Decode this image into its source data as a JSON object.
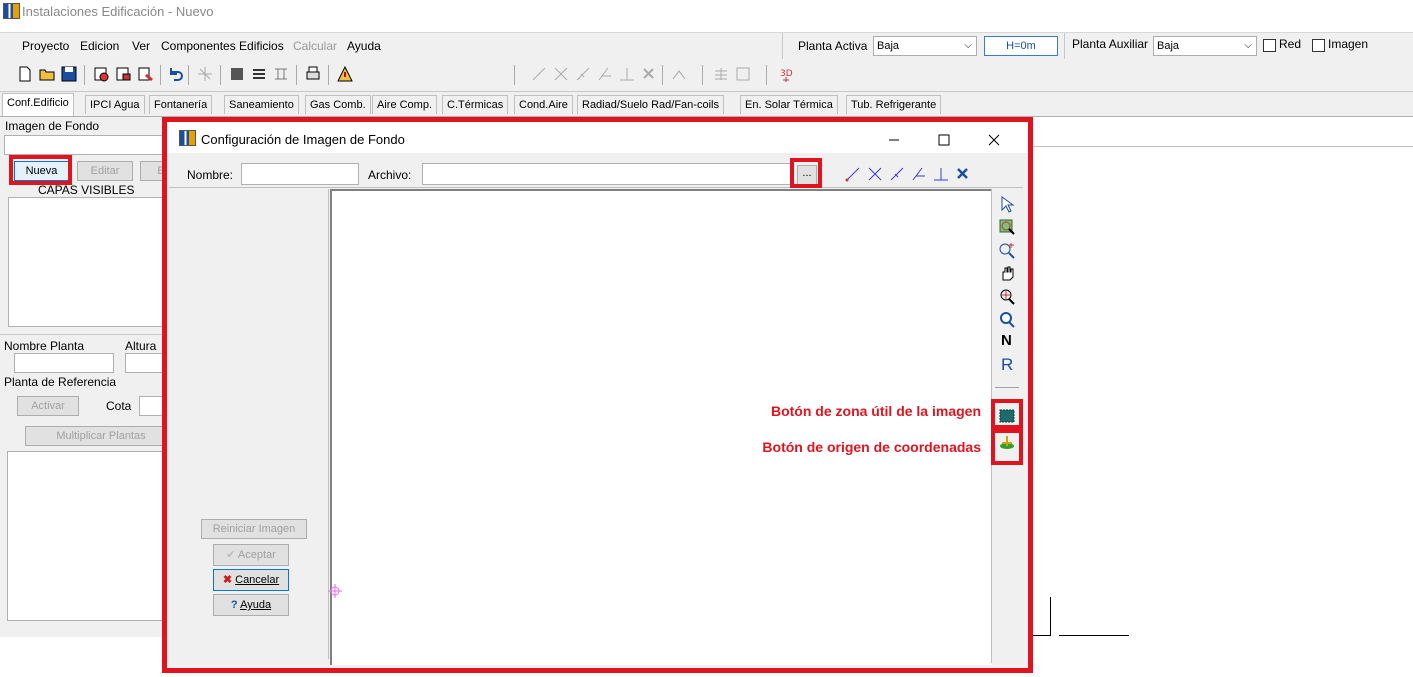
{
  "app": {
    "title": "Instalaciones Edificación - Nuevo"
  },
  "menu": [
    "Proyecto",
    "Edicion",
    "Ver",
    "Componentes Edificios",
    "Calcular",
    "Ayuda"
  ],
  "planta": {
    "activa_label": "Planta Activa",
    "activa_value": "Baja",
    "height_value": "H=0m",
    "auxiliar_label": "Planta Auxiliar",
    "auxiliar_value": "Baja",
    "red_label": "Red",
    "imagen_label": "Imagen"
  },
  "tabs": [
    "Conf.Edificio",
    "IPCI Agua",
    "Fontanería",
    "Saneamiento",
    "Gas Comb.",
    "Aire Comp.",
    "C.Térmicas",
    "Cond.Aire",
    "Radiad/Suelo Rad/Fan-coils",
    "En. Solar Térmica",
    "Tub. Refrigerante"
  ],
  "left_panel": {
    "imagen_de_fondo_label": "Imagen de Fondo",
    "nueva": "Nueva",
    "editar": "Editar",
    "borrar_partial": "B",
    "capas_visibles": "CAPAS VISIBLES",
    "nombre_planta": "Nombre Planta",
    "altura_partial": "Altura",
    "planta_referencia": "Planta de Referencia",
    "activar": "Activar",
    "cota": "Cota",
    "multiplicar": "Multiplicar Plantas"
  },
  "dialog": {
    "title": "Configuración de Imagen de Fondo",
    "nombre_label": "Nombre:",
    "nombre_value": "",
    "archivo_label": "Archivo:",
    "archivo_value": "",
    "browse_label": "...",
    "reiniciar": "Reiniciar Imagen",
    "aceptar": "Aceptar",
    "cancelar": "Cancelar",
    "ayuda": "Ayuda",
    "side_n": "N",
    "side_r": "R"
  },
  "annotations": {
    "zona_util": "Botón de zona útil de la imagen",
    "origen": "Botón de origen de coordenadas"
  },
  "colors": {
    "highlight": "#e0141e",
    "accent": "#1a4fa0"
  }
}
